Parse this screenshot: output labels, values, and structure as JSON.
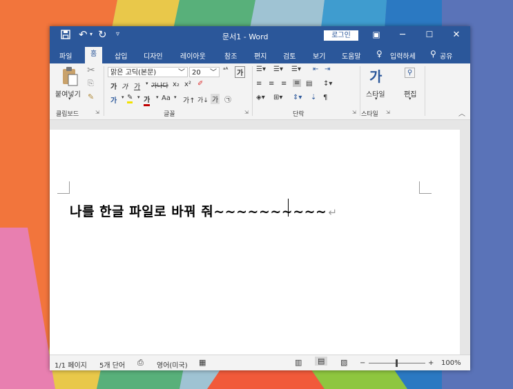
{
  "titlebar": {
    "save_icon": "save-icon",
    "undo_icon": "undo-icon",
    "redo_icon": "redo-icon",
    "title": "문서1  -  Word",
    "login": "로그인"
  },
  "tabs": [
    "파일",
    "홈",
    "삽입",
    "디자인",
    "레이아웃",
    "참조",
    "편지",
    "검토",
    "보기",
    "도움말"
  ],
  "tell_me": "입력하세",
  "share": "공유",
  "ribbon": {
    "paste_label": "붙여넣기",
    "clipboard_group": "클립보드",
    "font_name": "맑은 고딕(본문)",
    "font_size": "20",
    "font_group": "글꼴",
    "paragraph_group": "단락",
    "styles_label": "스타일",
    "styles_group": "스타일",
    "editing_label": "편집",
    "aa_label": "Aa"
  },
  "document": {
    "text": "나를 한글 파일로 바꿔 줘~~~~~~~~~~",
    "pilcrow": "↵"
  },
  "status": {
    "page": "1/1 페이지",
    "words": "5개 단어",
    "language": "영어(미국)",
    "zoom": "100%",
    "zoom_minus": "−",
    "zoom_plus": "+"
  },
  "colors": {
    "accent": "#2b579a",
    "highlight": "#f2e200",
    "font_red": "#c00000"
  }
}
